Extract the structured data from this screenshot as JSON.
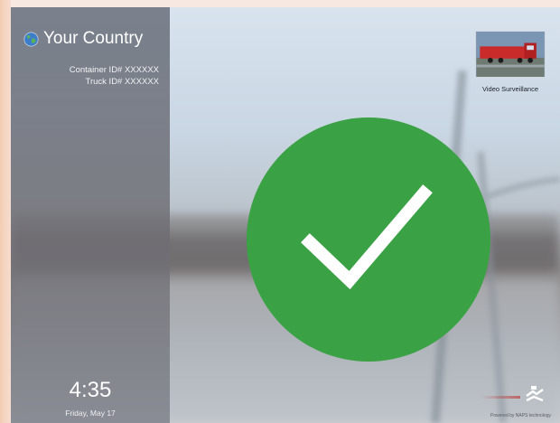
{
  "header": {
    "country_label": "Your Country"
  },
  "identifiers": {
    "container_id": "Container ID# XXXXXX",
    "truck_id": "Truck ID# XXXXXX"
  },
  "clock": {
    "time": "4:35",
    "date": "Friday, May 17"
  },
  "status": {
    "icon": "checkmark-icon",
    "color": "#3aa144"
  },
  "video": {
    "label": "Video Surveillance"
  },
  "footer": {
    "powered_by": "Powered by NAPS technology"
  }
}
